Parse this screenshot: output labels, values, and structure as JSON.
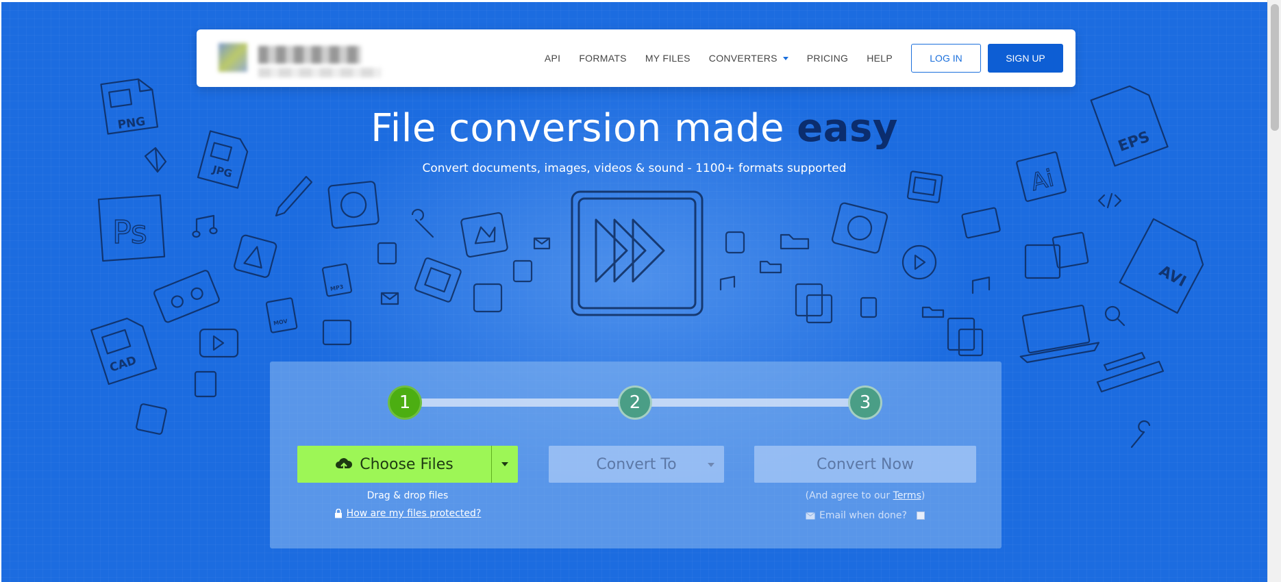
{
  "nav": {
    "links": [
      "API",
      "FORMATS",
      "MY FILES",
      "CONVERTERS",
      "PRICING",
      "HELP"
    ],
    "login_label": "LOG IN",
    "signup_label": "SIGN UP"
  },
  "hero": {
    "title_main": "File conversion made ",
    "title_emphasis": "easy",
    "subtitle": "Convert documents, images, videos & sound - 1100+ formats supported"
  },
  "steps": [
    "1",
    "2",
    "3"
  ],
  "converter": {
    "choose_label": "Choose Files",
    "convert_to_label": "Convert To",
    "convert_now_label": "Convert Now",
    "drag_text": "Drag & drop files",
    "protected_link": "How are my files protected?",
    "terms_prefix": "(And agree to our ",
    "terms_link": "Terms",
    "terms_suffix": ")",
    "email_label": "Email when done?"
  },
  "doodle_labels": {
    "png": "PNG",
    "jpg": "JPG",
    "ps": "Ps",
    "cad": "CAD",
    "eps": "EPS",
    "ai": "Ai",
    "avi": "AVI",
    "mov": "MOV",
    "mp3": "MP3"
  },
  "colors": {
    "hero_bg": "#1c6ce0",
    "accent": "#0d5ed4",
    "emphasis": "#0b2d6e",
    "step_active": "#4cae12",
    "step_inactive": "#4a9e86",
    "choose_button": "#9df656"
  },
  "icons": [
    "cloud-upload-icon",
    "lock-icon",
    "envelope-icon",
    "chevron-down-icon",
    "fast-forward-icon"
  ]
}
